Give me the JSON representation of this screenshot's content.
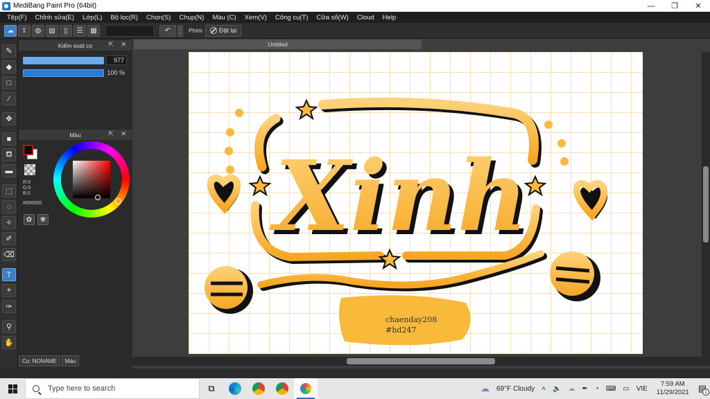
{
  "window": {
    "title": "MediBang Paint Pro (64bit)"
  },
  "menu": [
    "Tệp(F)",
    "Chỉnh sửa(E)",
    "Lớp(L)",
    "Bộ lọc(R)",
    "Chọn(S)",
    "Chụp(N)",
    "Màu (C)",
    "Xem(V)",
    "Công cụ(T)",
    "Cửa sổ(W)",
    "Cloud",
    "Help"
  ],
  "toolbar": {
    "key_label": "Phím",
    "reset_label": "Đặt lại"
  },
  "brush_panel": {
    "title": "Kiểm soát cọ",
    "size_value": "977",
    "opacity_value": "100 %"
  },
  "color_panel": {
    "title": "Màu",
    "r": "R:0",
    "g": "G:0",
    "b": "B:0",
    "hex": "#000000"
  },
  "document": {
    "tab_title": "Untitled"
  },
  "artwork": {
    "main_text": "Xinh",
    "credit_line1": "chaenday208",
    "credit_line2": "#hd247",
    "accent": "#f9b93a"
  },
  "status": {
    "brush_tab": "Co: NONAME",
    "color_tab": "Màu"
  },
  "taskbar": {
    "search_placeholder": "Type here to search",
    "weather": "69°F  Cloudy",
    "lang": "VIE",
    "time": "7:59 AM",
    "date": "11/29/2021",
    "notif_count": "1"
  }
}
